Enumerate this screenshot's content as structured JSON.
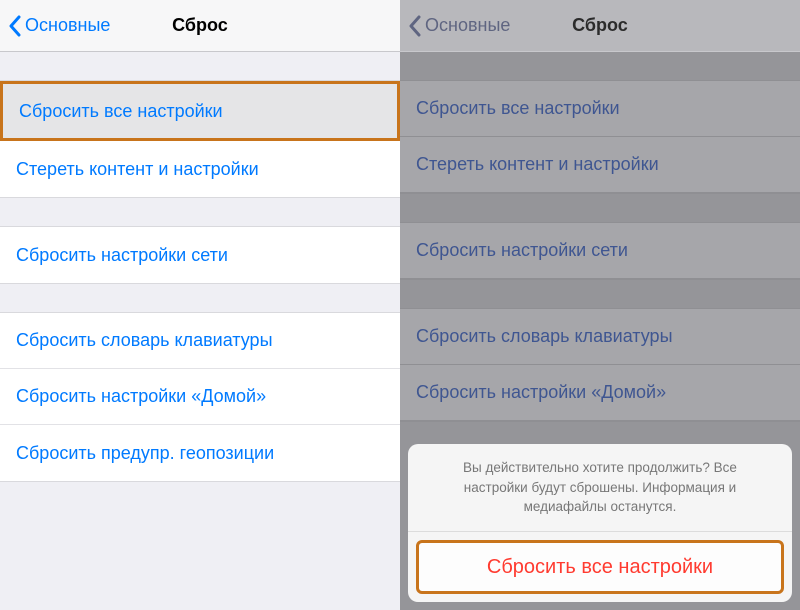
{
  "left": {
    "back_label": "Основные",
    "title": "Сброс",
    "group1": {
      "reset_all": "Сбросить все настройки",
      "erase_all": "Стереть контент и настройки"
    },
    "group2": {
      "reset_network": "Сбросить настройки сети"
    },
    "group3": {
      "reset_keyboard": "Сбросить словарь клавиатуры",
      "reset_home": "Сбросить настройки «Домой»",
      "reset_location": "Сбросить предупр. геопозиции"
    }
  },
  "right": {
    "back_label": "Основные",
    "title": "Сброс",
    "group1": {
      "reset_all": "Сбросить все настройки",
      "erase_all": "Стереть контент и настройки"
    },
    "group2": {
      "reset_network": "Сбросить настройки сети"
    },
    "group3": {
      "reset_keyboard": "Сбросить словарь клавиатуры",
      "reset_home": "Сбросить настройки «Домой»"
    },
    "actionsheet": {
      "message": "Вы действительно хотите продолжить? Все настройки будут сброшены. Информация и медиафайлы останутся.",
      "confirm": "Сбросить все настройки"
    }
  },
  "colors": {
    "link": "#007aff",
    "destructive": "#ff3b30",
    "highlight_border": "#c8741b"
  }
}
